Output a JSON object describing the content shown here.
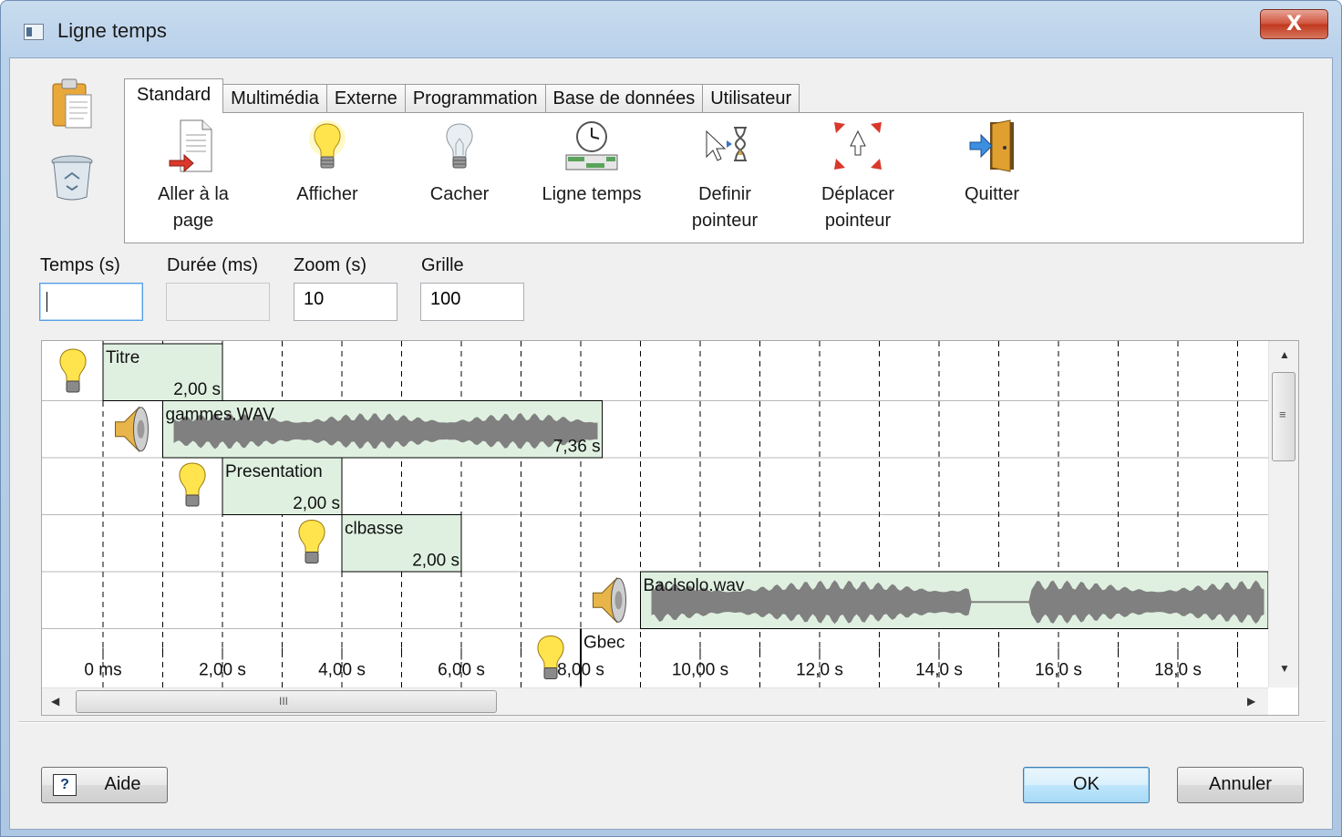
{
  "window": {
    "title": "Ligne temps",
    "close_label": "X"
  },
  "tabs": [
    {
      "label": "Standard"
    },
    {
      "label": "Multimédia"
    },
    {
      "label": "Externe"
    },
    {
      "label": "Programmation"
    },
    {
      "label": "Base de données"
    },
    {
      "label": "Utilisateur"
    }
  ],
  "tools": [
    {
      "line1": "Aller à la",
      "line2": "page",
      "icon": "goto-page-icon"
    },
    {
      "line1": "Afficher",
      "line2": "",
      "icon": "lightbulb-on-icon"
    },
    {
      "line1": "Cacher",
      "line2": "",
      "icon": "lightbulb-off-icon"
    },
    {
      "line1": "Ligne temps",
      "line2": "",
      "icon": "timeline-clock-icon"
    },
    {
      "line1": "Definir",
      "line2": "pointeur",
      "icon": "pointer-hourglass-icon"
    },
    {
      "line1": "Déplacer",
      "line2": "pointeur",
      "icon": "move-pointer-icon"
    },
    {
      "line1": "Quitter",
      "line2": "",
      "icon": "exit-door-icon"
    }
  ],
  "fields": {
    "temps": {
      "label": "Temps (s)",
      "value": ""
    },
    "duree": {
      "label": "Durée (ms)",
      "value": ""
    },
    "zoom": {
      "label": "Zoom (s)",
      "value": "10"
    },
    "grille": {
      "label": "Grille",
      "value": "100"
    }
  },
  "timeline": {
    "events": [
      {
        "row": 0,
        "kind": "show",
        "name": "Titre",
        "start": 0,
        "duration": 2.0,
        "duration_label": "2,00 s"
      },
      {
        "row": 1,
        "kind": "sound",
        "name": "gammes.WAV",
        "start": 1.0,
        "duration": 7.36,
        "duration_label": "7,36 s"
      },
      {
        "row": 2,
        "kind": "show",
        "name": "Presentation",
        "start": 2.0,
        "duration": 2.0,
        "duration_label": "2,00 s"
      },
      {
        "row": 3,
        "kind": "show",
        "name": "clbasse",
        "start": 4.0,
        "duration": 2.0,
        "duration_label": "2,00 s"
      },
      {
        "row": 4,
        "kind": "sound",
        "name": "Baclsolo.wav",
        "start": 9.0,
        "duration": 12.0,
        "duration_label": ""
      },
      {
        "row": 5,
        "kind": "show",
        "name": "Gbec",
        "start": 8.0,
        "duration": 0,
        "duration_label": ""
      }
    ],
    "ticks": [
      "0 ms",
      "2,00 s",
      "4,00 s",
      "6,00 s",
      "8,00 s",
      "10,00 s",
      "12,0 s",
      "14,0 s",
      "16,0 s",
      "18,0 s"
    ],
    "hscroll_grip": "III",
    "vscroll_grip": "≡"
  },
  "buttons": {
    "help": "Aide",
    "help_icon": "?",
    "ok": "OK",
    "cancel": "Annuler"
  }
}
